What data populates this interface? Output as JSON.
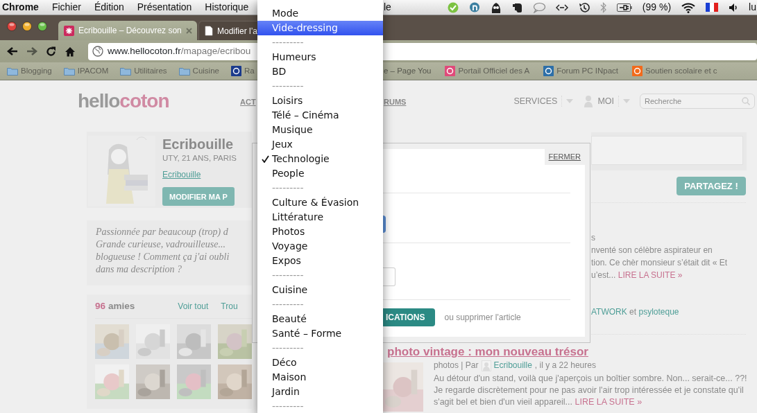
{
  "menu_bar": {
    "app_name": "Chrome",
    "menus": [
      "Fichier",
      "Édition",
      "Présentation",
      "Historique"
    ],
    "cut_menu": "le",
    "battery": "(99 %)",
    "clock": "lu"
  },
  "tabs": [
    {
      "title": "Ecribouille – Découvrez son",
      "selected": true
    },
    {
      "title": "Modifier l’a",
      "selected": false
    }
  ],
  "address": {
    "host": "www.hellocoton.fr",
    "path": "/mapage/ecribou"
  },
  "bookmarks_left": [
    {
      "label": "Blogging",
      "kind": "folder"
    },
    {
      "label": "IPACOM",
      "kind": "folder"
    },
    {
      "label": "Utilitaires",
      "kind": "folder"
    },
    {
      "label": "Cuisine",
      "kind": "folder"
    },
    {
      "label": "Ra",
      "kind": "site",
      "color": "#1b3b8c"
    }
  ],
  "bookmarks_right": [
    {
      "label": "e – Page You",
      "kind": "text"
    },
    {
      "label": "Portail Officiel des A",
      "kind": "site",
      "color": "#e04a7a"
    },
    {
      "label": "Forum PC INpact",
      "kind": "site",
      "color": "#2d6fa8"
    },
    {
      "label": "Soutien scolaire et c",
      "kind": "site",
      "color": "#f26a1b"
    }
  ],
  "page": {
    "logo": {
      "first_part": "hello",
      "second_part": "coton"
    },
    "nav_left": [
      "ACT",
      "RUMS"
    ],
    "nav_right": [
      {
        "label": "SERVICES",
        "kind": "menu"
      },
      {
        "label": "MOI",
        "kind": "user"
      }
    ],
    "search": {
      "placeholder": "Recherche"
    },
    "profile": {
      "name": "Ecribouille",
      "info": "UTY, 21 ANS, PARIS",
      "link": "Ecribouille",
      "button": "MODIFIER MA P"
    },
    "description_lines": [
      "Passionnée par beaucoup (trop) d",
      "Grande curieuse, vadrouilleuse...",
      "blogueuse ! Comment ça j'ai oubli",
      "dans ma description ?"
    ],
    "friends": {
      "count": "96",
      "label": "amies",
      "links": [
        "Voir tout",
        "Trou"
      ]
    },
    "share_button": "PARTAGEZ !",
    "feed_lines": [
      "s",
      "nventé son célèbre aspirateur en",
      "tion. Ce chèr monsieur s’était dit « Et",
      "u’est..."
    ],
    "feed_more": "LIRE LA SUITE »",
    "likes": {
      "first": "ATWORK",
      "joiner": "et",
      "second": "psyloteque"
    },
    "article": {
      "title": "photo vintage : mon nouveau trésor",
      "category": "photos | Par",
      "author": "Ecribouille",
      "time": ", il y a 22 heures",
      "text": "Au détour d'un stand, voilà que j'aperçois un boîtier sombre. Non... serait-ce... ??! Je regarde discrètement pour ne pas avoir l'air trop intéressée et je constate qu'il s'agit bel et bien d'un vieil appareil...",
      "more": "LIRE LA SUITE »"
    }
  },
  "dialog": {
    "close": "FERMER",
    "submit": "ICATIONS",
    "delete_link": "ou supprimer l'article"
  },
  "category_menu": [
    {
      "label": "Mode",
      "selected": false,
      "checked": false,
      "disabled": false
    },
    {
      "label": "Vide-dressing",
      "selected": true,
      "checked": false,
      "disabled": false
    },
    {
      "label": "---------",
      "selected": false,
      "checked": false,
      "disabled": true
    },
    {
      "label": "Humeurs",
      "selected": false,
      "checked": false,
      "disabled": false
    },
    {
      "label": "BD",
      "selected": false,
      "checked": false,
      "disabled": false
    },
    {
      "label": "---------",
      "selected": false,
      "checked": false,
      "disabled": true
    },
    {
      "label": "Loisirs",
      "selected": false,
      "checked": false,
      "disabled": false
    },
    {
      "label": "Télé – Cinéma",
      "selected": false,
      "checked": false,
      "disabled": false
    },
    {
      "label": "Musique",
      "selected": false,
      "checked": false,
      "disabled": false
    },
    {
      "label": "Jeux",
      "selected": false,
      "checked": false,
      "disabled": false
    },
    {
      "label": "Technologie",
      "selected": false,
      "checked": true,
      "disabled": false
    },
    {
      "label": "People",
      "selected": false,
      "checked": false,
      "disabled": false
    },
    {
      "label": "---------",
      "selected": false,
      "checked": false,
      "disabled": true
    },
    {
      "label": "Culture & Évasion",
      "selected": false,
      "checked": false,
      "disabled": false
    },
    {
      "label": "Littérature",
      "selected": false,
      "checked": false,
      "disabled": false
    },
    {
      "label": "Photos",
      "selected": false,
      "checked": false,
      "disabled": false
    },
    {
      "label": "Voyage",
      "selected": false,
      "checked": false,
      "disabled": false
    },
    {
      "label": "Expos",
      "selected": false,
      "checked": false,
      "disabled": false
    },
    {
      "label": "---------",
      "selected": false,
      "checked": false,
      "disabled": true
    },
    {
      "label": "Cuisine",
      "selected": false,
      "checked": false,
      "disabled": false
    },
    {
      "label": "---------",
      "selected": false,
      "checked": false,
      "disabled": true
    },
    {
      "label": "Beauté",
      "selected": false,
      "checked": false,
      "disabled": false
    },
    {
      "label": "Santé – Forme",
      "selected": false,
      "checked": false,
      "disabled": false
    },
    {
      "label": "---------",
      "selected": false,
      "checked": false,
      "disabled": true
    },
    {
      "label": "Déco",
      "selected": false,
      "checked": false,
      "disabled": false
    },
    {
      "label": "Maison",
      "selected": false,
      "checked": false,
      "disabled": false
    },
    {
      "label": "Jardin",
      "selected": false,
      "checked": false,
      "disabled": false
    },
    {
      "label": "---------",
      "selected": false,
      "checked": false,
      "disabled": true
    }
  ]
}
